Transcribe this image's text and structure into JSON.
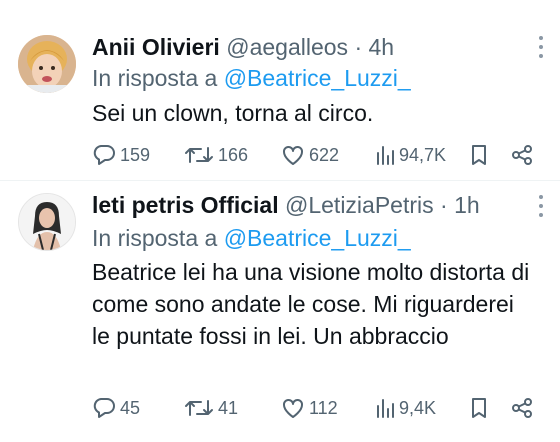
{
  "tweets": [
    {
      "name": "Anii Olivieri",
      "handle": "@aegalleos",
      "separator": "·",
      "time": "4h",
      "reply_prefix": "In risposta a",
      "reply_to": "@Beatrice_Luzzi_",
      "text": "Sei un clown, torna al circo.",
      "replies": "159",
      "retweets": "166",
      "likes": "622",
      "views": "94,7K"
    },
    {
      "name": "leti petris Official",
      "handle": "@LetiziaPetris",
      "separator": "·",
      "time": "1h",
      "reply_prefix": "In risposta a",
      "reply_to": "@Beatrice_Luzzi_",
      "text": "Beatrice lei ha una visione molto distorta di come sono andate le cose. Mi riguarderei le puntate fossi in lei. Un abbraccio",
      "replies": "45",
      "retweets": "41",
      "likes": "112",
      "views": "9,4K"
    }
  ],
  "colors": {
    "text": "#0f1419",
    "secondary": "#536471",
    "link": "#1d9bf0",
    "divider": "#eff3f4"
  },
  "icons": [
    "more-icon",
    "reply-icon",
    "retweet-icon",
    "like-icon",
    "views-icon",
    "bookmark-icon",
    "share-icon"
  ]
}
